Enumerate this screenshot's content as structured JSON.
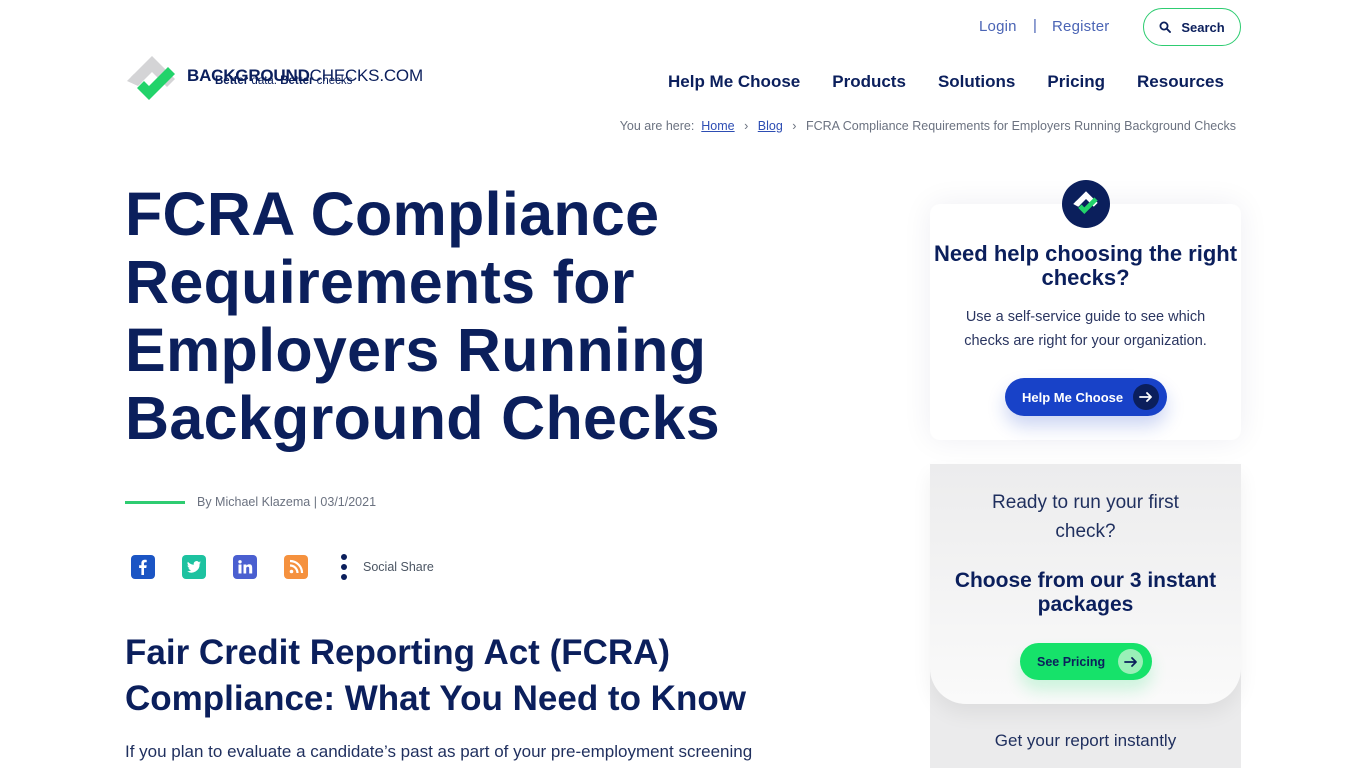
{
  "header": {
    "login_label": "Login",
    "separator": "|",
    "register_label": "Register",
    "search_label": "Search",
    "logo": {
      "brand_bold": "BACKGROUND",
      "brand_light": "CHECKS.COM",
      "tag_bold_1": "Better",
      "tag_light_1": " data. ",
      "tag_bold_2": "Better",
      "tag_light_2": " checks"
    },
    "nav": [
      {
        "label": "Help Me Choose"
      },
      {
        "label": "Products"
      },
      {
        "label": "Solutions"
      },
      {
        "label": "Pricing"
      },
      {
        "label": "Resources"
      }
    ]
  },
  "breadcrumb": {
    "prefix": "You are here:",
    "items": [
      {
        "label": "Home"
      },
      {
        "label": "Blog"
      }
    ],
    "current": "FCRA Compliance Requirements for Employers Running Background Checks",
    "separator": "›"
  },
  "article": {
    "title": "FCRA Compliance Requirements for Employers Running Background Checks",
    "byline": "By Michael Klazema | 03/1/2021",
    "social": {
      "icons": [
        "facebook-icon",
        "twitter-icon",
        "linkedin-icon",
        "rss-icon"
      ],
      "share_label": "Social Share"
    },
    "subheading": "Fair Credit Reporting Act (FCRA) Compliance: What You Need to Know",
    "intro": "If you plan to evaluate a candidate’s past as part of your pre-employment screening"
  },
  "sidebar": {
    "help_card": {
      "heading": "Need help choosing the right checks?",
      "text": "Use a self-service guide to see which checks are right for your organization.",
      "button_label": "Help Me Choose"
    },
    "pricing_card": {
      "question": "Ready to run your first check?",
      "heading": "Choose from our 3 instant packages",
      "button_label": "See Pricing",
      "footer": "Get your report instantly"
    }
  },
  "colors": {
    "navy": "#0b1f5c",
    "green": "#2ecc71",
    "button_blue": "#1842c8",
    "button_green": "#16e26a"
  }
}
